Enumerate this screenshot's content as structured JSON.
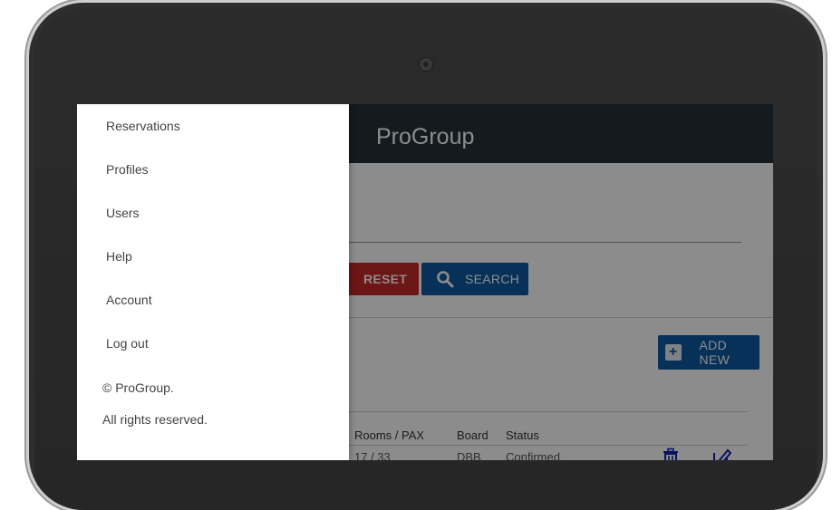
{
  "app": {
    "title": "ProGroup"
  },
  "toolbar": {
    "reset_label": "RESET",
    "search_label": "SEARCH",
    "add_new_label": "ADD NEW"
  },
  "table": {
    "headers": {
      "rooms": "Rooms / PAX",
      "board": "Board",
      "status": "Status"
    },
    "rows": [
      {
        "rooms": "17 / 33",
        "board": "DBB",
        "status": "Confirmed"
      }
    ]
  },
  "drawer": {
    "items": [
      {
        "label": "Reservations"
      },
      {
        "label": "Profiles"
      },
      {
        "label": "Users"
      },
      {
        "label": "Help"
      },
      {
        "label": "Account"
      },
      {
        "label": "Log out"
      }
    ],
    "footer": {
      "copyright": "© ProGroup.",
      "rights": "All rights reserved."
    }
  },
  "icons": {
    "search": "search-icon",
    "add": "plus-icon",
    "delete": "trash-icon",
    "edit": "edit-icon",
    "camera": "camera-icon"
  },
  "colors": {
    "header": "#263238",
    "reset": "#c62828",
    "primary": "#0d5aa0",
    "action_icons": "#0d1fa8"
  }
}
